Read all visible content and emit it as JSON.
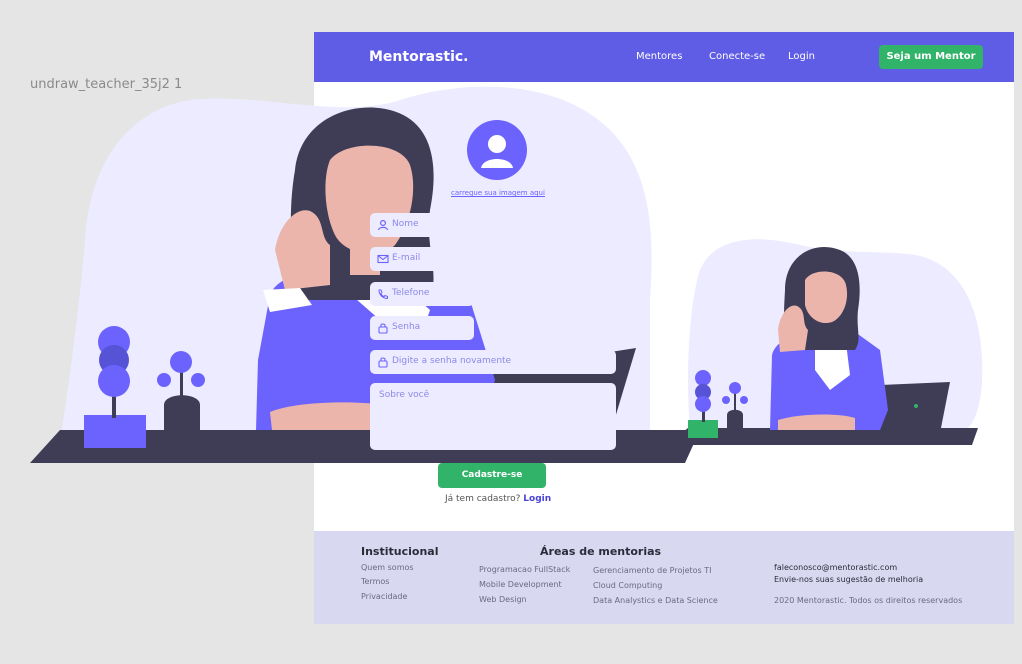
{
  "canvas": {
    "frame_label": "undraw_teacher_35j2 1"
  },
  "navbar": {
    "brand": "Mentorastic.",
    "links": [
      "Mentores",
      "Conecte-se",
      "Login"
    ],
    "cta_label": "Seja um Mentor",
    "color": "#5f5ce6"
  },
  "form": {
    "upload_label": "carregue sua imagem aqui",
    "fields": [
      {
        "placeholder": "Nome",
        "icon": "user-icon"
      },
      {
        "placeholder": "E-mail",
        "icon": "mail-icon"
      },
      {
        "placeholder": "Telefone",
        "icon": "phone-icon"
      },
      {
        "placeholder": "Senha",
        "icon": "lock-icon"
      },
      {
        "placeholder": "Digite a senha novamente",
        "icon": "lock-icon"
      }
    ],
    "about_placeholder": "Sobre você",
    "submit_label": "Cadastre-se",
    "login_prompt": "Já tem cadastro?",
    "login_link": "Login"
  },
  "footer": {
    "institucional_title": "Institucional",
    "institucional_items": [
      "Quem somos",
      "Termos",
      "Privacidade"
    ],
    "areas_title": "Áreas de mentorias",
    "areas_col1": [
      "Programacao FullStack",
      "Mobile Development",
      "Web Design"
    ],
    "areas_col2": [
      "Gerenciamento de Projetos TI",
      "Cloud Computing",
      "Data Analystics e Data Science"
    ],
    "email": "faleconosco@mentorastic.com",
    "suggestion": "Envie-nos suas sugestão de melhoria",
    "copyright": "2020 Mentorastic. Todos os direitos reservados"
  },
  "colors": {
    "accent": "#6c63ff",
    "success": "#32b36a",
    "footer_bg": "#d8d8f1",
    "input_bg": "#ecebff"
  }
}
